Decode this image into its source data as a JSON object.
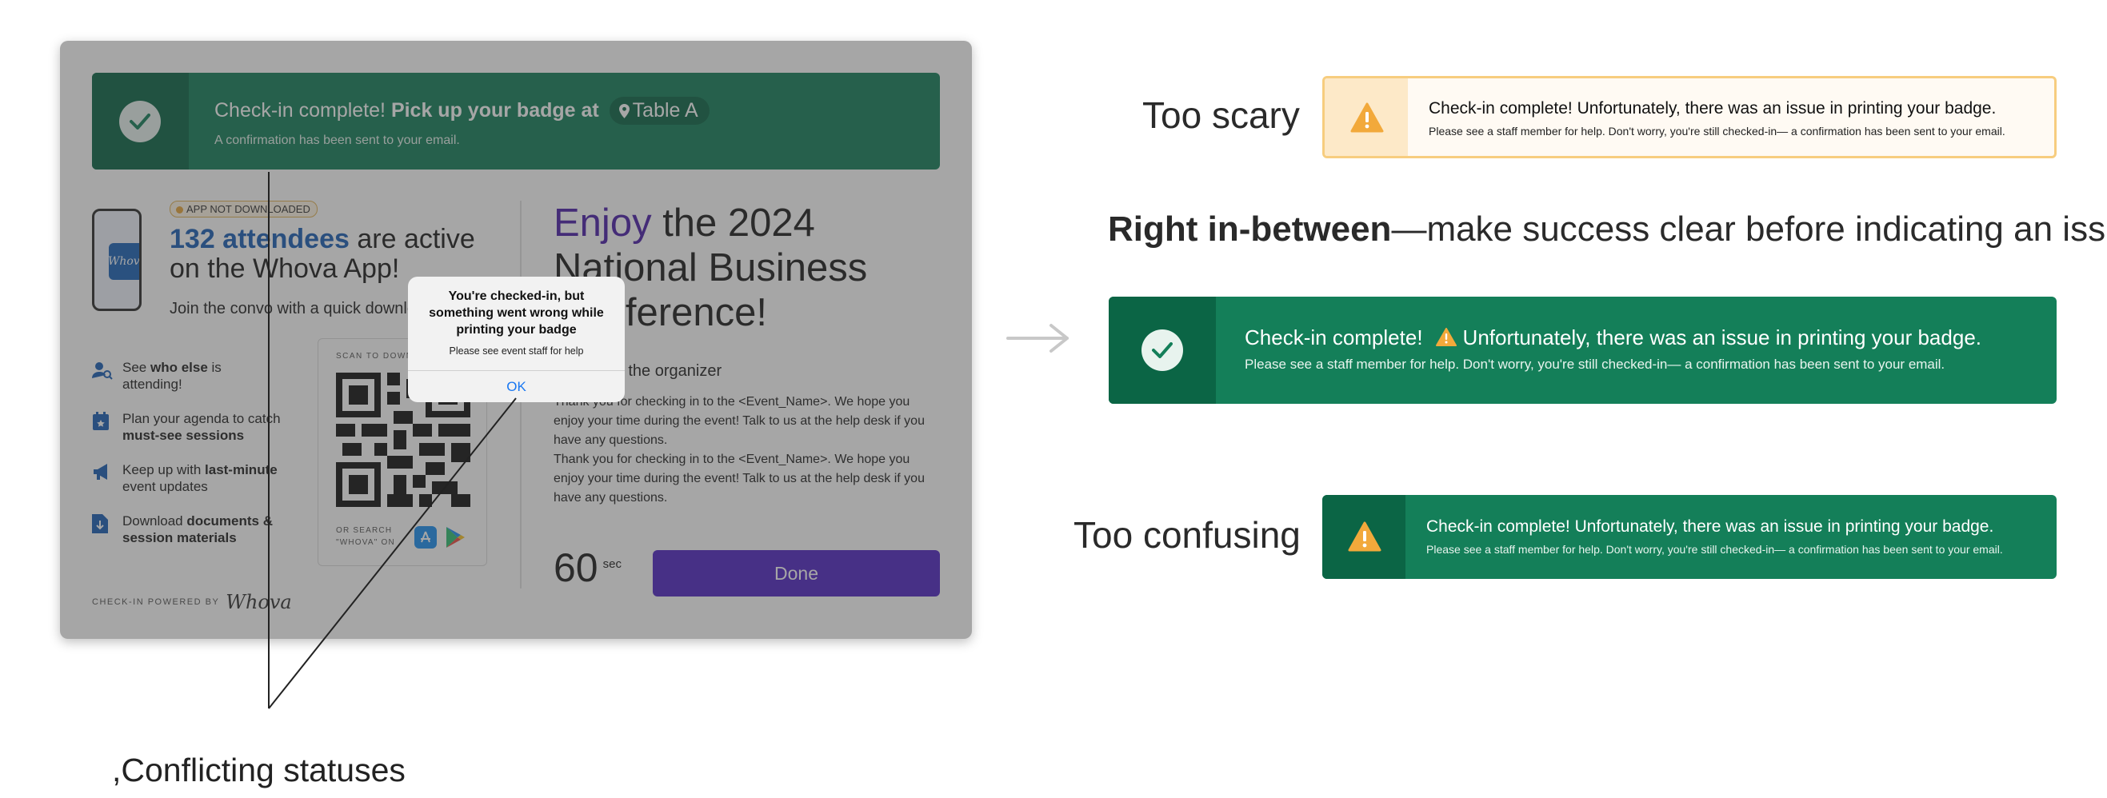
{
  "mock": {
    "banner": {
      "title_plain": "Check-in complete! ",
      "title_bold": "Pick up your badge at",
      "location": "Table A",
      "subtitle": "A confirmation has been sent to your email."
    },
    "badge": "APP NOT DOWNLOADED",
    "attendees_bold": "132 attendees",
    "attendees_rest": " are active on the Whova App!",
    "join_text": "Join the convo with a quick download",
    "phone_logo": "Whova",
    "features": [
      {
        "icon": "people-search-icon",
        "pre": "See ",
        "bold": "who else",
        "post": " is attending!"
      },
      {
        "icon": "calendar-icon",
        "pre": "Plan your agenda to catch ",
        "bold": "must-see sessions",
        "post": ""
      },
      {
        "icon": "megaphone-icon",
        "pre": "Keep up with ",
        "bold": "last-minute",
        "post": " event updates"
      },
      {
        "icon": "download-doc-icon",
        "pre": "Download ",
        "bold": "documents & session materials",
        "post": ""
      }
    ],
    "qr_label": "SCAN TO DOWNLOAD",
    "qr_or": "OR SEARCH",
    "qr_search": "\"WHOVA\" ON",
    "enjoy_word": "Enjoy",
    "enjoy_rest": " the 2024 National Business Conference!",
    "organizer_title": "Note from the organizer",
    "organizer_msg_1": "Thank you for checking in to the <Event_Name>. We hope you enjoy your time during the event! Talk to us at the help desk if you have any questions.",
    "organizer_msg_2": "Thank you for checking in to the <Event_Name>. We hope you enjoy your time during the event! Talk to us at the help desk if you have any questions.",
    "timer_value": "60",
    "timer_unit": "sec",
    "done_label": "Done",
    "powered_by": "CHECK-IN POWERED BY",
    "powered_brand": "Whova",
    "alert": {
      "title": "You're checked-in, but something went wrong while printing your badge",
      "message": "Please see event staff for help",
      "ok": "OK"
    }
  },
  "annotation_conflicting": ",Conflicting statuses",
  "options": {
    "too_scary_label": "Too scary",
    "too_confusing_label": "Too confusing",
    "right_bold": "Right in-between",
    "right_rest": "—make success clear before indicating an issue.",
    "scary_card": {
      "title": "Check-in complete!  Unfortunately, there was an issue in printing your badge.",
      "body": "Please see a staff member for help. Don't worry, you're still checked-in— a confirmation has been sent to your email."
    },
    "right_card": {
      "title_a": "Check-in complete!",
      "title_b": "Unfortunately, there was an issue in printing your badge.",
      "body": "Please see a staff member for help. Don't worry, you're still checked-in— a confirmation has been sent to your email."
    },
    "confusing_card": {
      "title": "Check-in complete!  Unfortunately, there was an issue in printing your badge.",
      "body": "Please see a staff member for help. Don't worry, you're still checked-in— a confirmation has been sent to your email."
    }
  },
  "colors": {
    "success_green": "#147f59",
    "success_dark": "#0b6545",
    "warning_amber": "#f2a93b",
    "warning_bg": "#fffaf3",
    "warning_border": "#f7cd7f",
    "cta_purple": "#5025c4",
    "brand_blue": "#1b5fb5"
  }
}
